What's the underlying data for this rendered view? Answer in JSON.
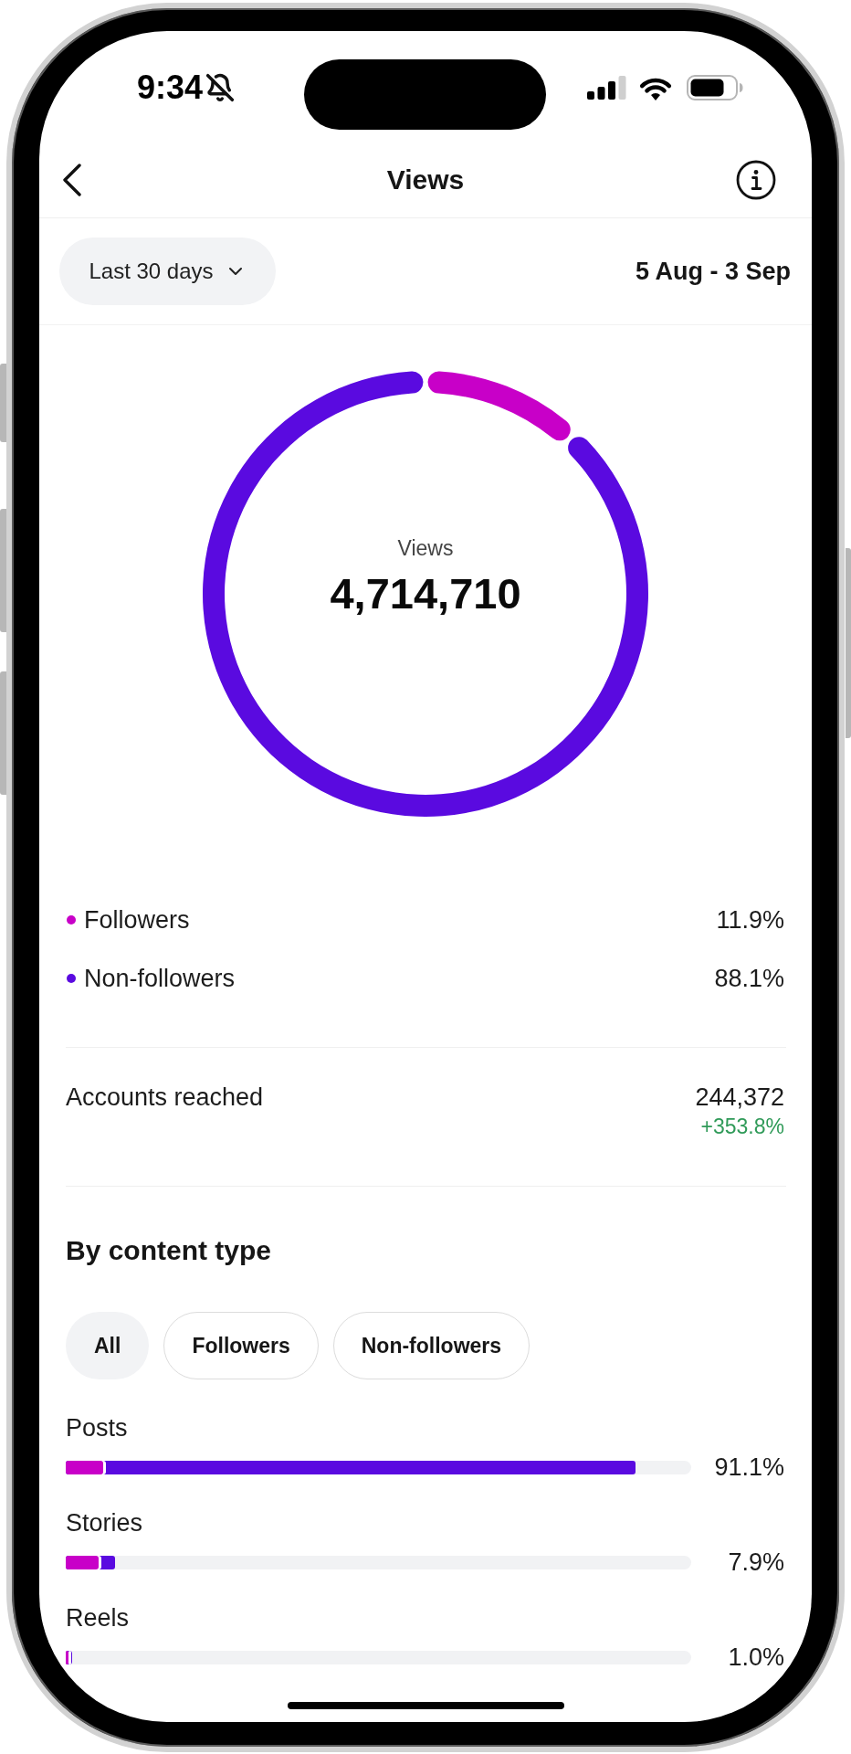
{
  "status_bar": {
    "time": "9:34"
  },
  "header": {
    "title": "Views"
  },
  "date_filter": {
    "range": "Last 30 days",
    "dates": "5 Aug - 3 Sep"
  },
  "views_chart": {
    "label": "Views",
    "total": "4,714,710",
    "chart_data": {
      "type": "donut",
      "categories": [
        "Followers",
        "Non-followers"
      ],
      "values": [
        11.9,
        88.1
      ]
    }
  },
  "legend": [
    {
      "value": "11.9%",
      "color": "#c800c8"
    },
    {
      "value": "88.1%",
      "color": "#5a0ae0"
    }
  ],
  "accounts_reached": {
    "label": "Accounts reached",
    "value": "244,372",
    "change": "+353.8%"
  },
  "content_type": {
    "title": "By content type",
    "filters": [
      {
        "label": "All",
        "selected": true
      },
      {
        "label": "Followers",
        "selected": false
      },
      {
        "label": "Non-followers",
        "selected": false
      }
    ],
    "rows": [
      {
        "label": "Posts",
        "value": "91.1%",
        "segments": [
          {
            "level": 0.06,
            "color": "#c800c8"
          },
          {
            "level": 0.911,
            "color": "#5a0ae0"
          }
        ]
      },
      {
        "label": "Stories",
        "value": "7.9%",
        "segments": [
          {
            "level": 0.053,
            "color": "#c800c8"
          },
          {
            "level": 0.079,
            "color": "#5a0ae0"
          }
        ]
      },
      {
        "label": "Reels",
        "value": "1.0%",
        "segments": [
          {
            "level": 0.004,
            "color": "#c800c8"
          },
          {
            "level": 0.01,
            "color": "#5a0ae0"
          }
        ]
      }
    ]
  }
}
